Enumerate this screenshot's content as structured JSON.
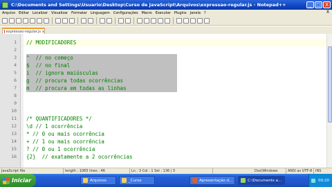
{
  "window": {
    "title": "C:\\Documents and Settings\\Usuario\\Desktop\\Curso de JavaScript\\Arquivos\\expressao-regular.js - Notepad++",
    "controls": [
      "_",
      "□",
      "X"
    ]
  },
  "menu": {
    "items": [
      "Arquivo",
      "Editar",
      "Localizar",
      "Visualizar",
      "Formatar",
      "Linguagem",
      "Configurações",
      "Macro",
      "Executar",
      "Plugins",
      "Janela",
      "?"
    ],
    "close_label": "X"
  },
  "tab": {
    "label": "expressao-regular.js",
    "close": "x"
  },
  "editor": {
    "lines": [
      {
        "num": "1",
        "text": "// MODIFICADORES",
        "cls": "cmt"
      },
      {
        "num": "2",
        "text": "",
        "cls": "cmt"
      },
      {
        "num": "3",
        "text": "^  // no começo",
        "cls": "cmt"
      },
      {
        "num": "4",
        "text": "$  // no final",
        "cls": "cmt"
      },
      {
        "num": "5",
        "text": "i  // ignora maiúsculas",
        "cls": "cmt"
      },
      {
        "num": "6",
        "text": "g  // procura todas ocorrências",
        "cls": "cmt"
      },
      {
        "num": "7",
        "text": "m  // procura em todas as linhas",
        "cls": "cmt"
      },
      {
        "num": "8",
        "text": "",
        "cls": "cmt"
      },
      {
        "num": "9",
        "text": "",
        "cls": "cmt"
      },
      {
        "num": "10",
        "text": "",
        "cls": "cmt"
      },
      {
        "num": "11",
        "text": "/* QUANTIFICADORES */",
        "cls": "cmt"
      },
      {
        "num": "12",
        "text": "\\d // 1 ocorrência",
        "cls": "cmt"
      },
      {
        "num": "13",
        "text": "* // 0 ou mais ocorrência",
        "cls": "cmt"
      },
      {
        "num": "14",
        "text": "+ // 1 ou mais ocorrência",
        "cls": "cmt"
      },
      {
        "num": "15",
        "text": "? // 0 ou 1 ocorrência",
        "cls": "cmt"
      },
      {
        "num": "16",
        "text": "{2}  // exatamente a 2 ocorrências",
        "cls": "cmt"
      }
    ]
  },
  "status": {
    "file_type": "JavaScript file",
    "length": "length : 1065    lines : 46",
    "position": "Ln : 3    Col : 1    Sel : 136 | 5",
    "eol": "Dos\\Windows",
    "encoding": "ANSI as UTF-8",
    "mode": "INS"
  },
  "taskbar": {
    "start_label": "Iniciar",
    "tasks": [
      "Arquivos",
      "_Curso",
      "Apresentação d...",
      "C:\\Documents a..."
    ],
    "clock": "00:20"
  }
}
